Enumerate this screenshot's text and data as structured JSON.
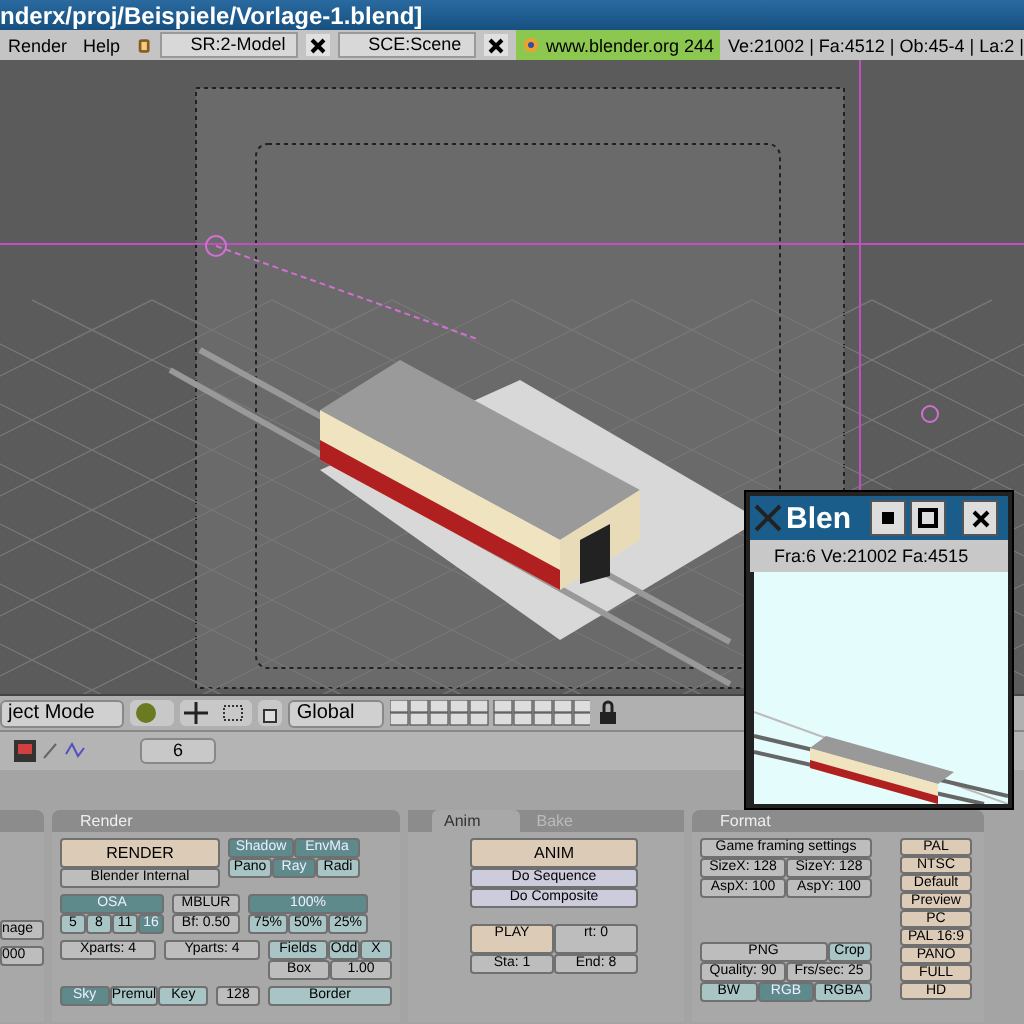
{
  "window": {
    "title": "nderx/proj/Beispiele/Vorlage-1.blend]"
  },
  "menu": [
    "Render",
    "Help"
  ],
  "screen_selector": "SR:2-Model",
  "scene_selector": "SCE:Scene",
  "version_badge": "www.blender.org 244",
  "stats": "Ve:21002 | Fa:4512 | Ob:45-4 | La:2 |",
  "viewport_header": {
    "mode": "ject Mode",
    "orientation": "Global"
  },
  "buttons_header": {
    "frame": "6"
  },
  "left_panel": {
    "buttons": [
      "nage",
      "000"
    ]
  },
  "render_panel": {
    "title": "Render",
    "render_button": "RENDER",
    "renderer": "Blender Internal",
    "toggles": [
      {
        "label": "Shadow",
        "on": true
      },
      {
        "label": "EnvMa",
        "on": true
      },
      {
        "label": "Pano",
        "on": false
      },
      {
        "label": "Ray",
        "on": true
      },
      {
        "label": "Radi",
        "on": false
      }
    ],
    "osa": {
      "label": "OSA",
      "on": true,
      "options": [
        {
          "label": "5",
          "selected": false
        },
        {
          "label": "8",
          "selected": false
        },
        {
          "label": "11",
          "selected": false
        },
        {
          "label": "16",
          "selected": true
        }
      ]
    },
    "mblur": "MBLUR",
    "blur_factor": "Bf: 0.50",
    "scale": {
      "label": "100%",
      "options": [
        {
          "label": "75%",
          "selected": false
        },
        {
          "label": "50%",
          "selected": false
        },
        {
          "label": "25%",
          "selected": false
        }
      ]
    },
    "xparts": "Xparts: 4",
    "yparts": "Yparts: 4",
    "field_toggles": [
      {
        "label": "Fields",
        "on": false
      },
      {
        "label": "Odd",
        "on": false
      },
      {
        "label": "X",
        "on": false
      }
    ],
    "filter": "Box",
    "filter_size": "1.00",
    "alpha_modes": [
      {
        "label": "Sky",
        "selected": true
      },
      {
        "label": "Premul",
        "selected": false
      },
      {
        "label": "Key",
        "selected": false
      }
    ],
    "bits": "128",
    "border": "Border"
  },
  "anim_panel": {
    "tabs": [
      {
        "label": "Anim",
        "selected": true
      },
      {
        "label": "Bake",
        "selected": false
      }
    ],
    "anim_button": "ANIM",
    "sequence_button": "Do Sequence",
    "composite_button": "Do Composite",
    "play_button": "PLAY",
    "rt": "rt: 0",
    "start": "Sta: 1",
    "end": "End: 8"
  },
  "format_panel": {
    "title": "Format",
    "game_framing": "Game framing settings",
    "size_x": "SizeX: 128",
    "size_y": "SizeY: 128",
    "asp_x": "AspX: 100",
    "asp_y": "AspY: 100",
    "file_type": "PNG",
    "crop": "Crop",
    "quality": "Quality: 90",
    "fps": "Frs/sec: 25",
    "color_modes": [
      {
        "label": "BW",
        "selected": false
      },
      {
        "label": "RGB",
        "selected": true
      },
      {
        "label": "RGBA",
        "selected": false
      }
    ],
    "presets": [
      "PAL",
      "NTSC",
      "Default",
      "Preview",
      "PC",
      "PAL 16:9",
      "PANO",
      "FULL",
      "HD"
    ]
  },
  "render_window": {
    "title": "Blen",
    "stats": "Fra:6  Ve:21002 Fa:4515"
  }
}
